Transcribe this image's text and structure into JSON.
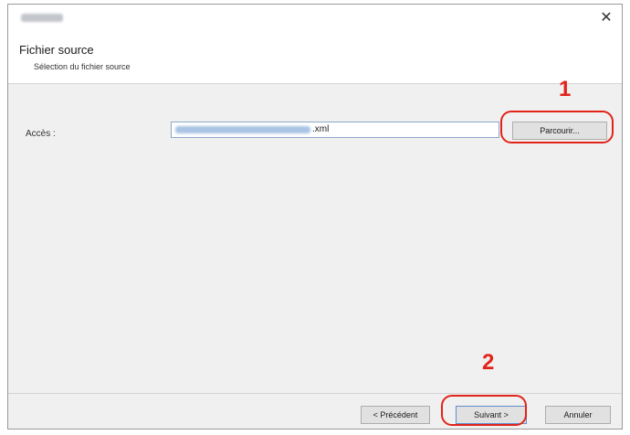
{
  "window": {
    "close_glyph": "✕"
  },
  "header": {
    "title": "Fichier source",
    "subtitle": "Sélection du fichier source"
  },
  "form": {
    "path_label": "Accès :",
    "path_value_suffix": ".xml",
    "browse_label": "Parcourir..."
  },
  "footer": {
    "prev_label": "< Précédent",
    "next_label": "Suivant >",
    "cancel_label": "Annuler"
  },
  "annotations": {
    "step1": "1",
    "step2": "2",
    "highlight_color": "#e2231a"
  },
  "colors": {
    "window_bg": "#f0f0f0",
    "header_bg": "#ffffff",
    "button_bg": "#e1e1e1",
    "input_border": "#8aa8c8"
  }
}
